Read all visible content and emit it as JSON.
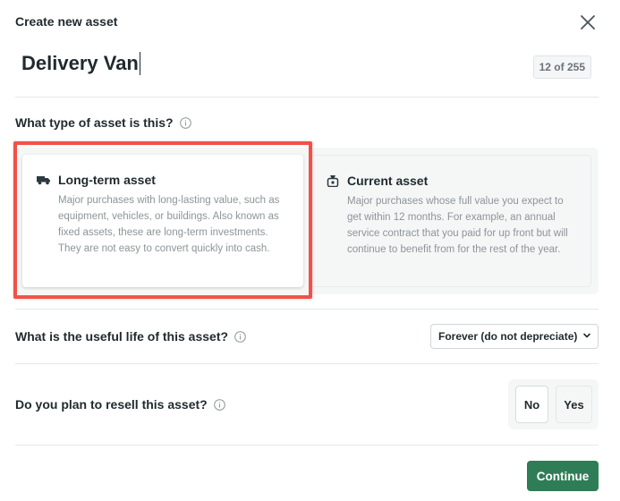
{
  "dialog": {
    "title": "Create new asset",
    "close_icon": "close-icon"
  },
  "asset_name": {
    "value": "Delivery Van",
    "count_label": "12 of 255"
  },
  "asset_type": {
    "question": "What type of asset is this?",
    "selected": "long-term",
    "options": [
      {
        "icon": "truck-icon",
        "title": "Long-term asset",
        "description": "Major purchases with long-lasting value, such as equipment, vehicles, or buildings. Also known as fixed assets, these are long-term investments. They are not easy to convert quickly into cash."
      },
      {
        "icon": "money-bag-icon",
        "title": "Current asset",
        "description": "Major purchases whose full value you expect to get within 12 months. For example, an annual service contract that you paid for up front but will continue to benefit from for the rest of the year."
      }
    ]
  },
  "useful_life": {
    "question": "What is the useful life of this asset?",
    "selected_value": "Forever (do not depreciate)"
  },
  "resell": {
    "question": "Do you plan to resell this asset?",
    "no_label": "No",
    "yes_label": "Yes",
    "selected": "No"
  },
  "footer": {
    "continue_label": "Continue"
  },
  "colors": {
    "primary": "#2f7d57",
    "highlight": "#f0524a",
    "text": "#1f2a2e",
    "muted": "#8c9499"
  }
}
